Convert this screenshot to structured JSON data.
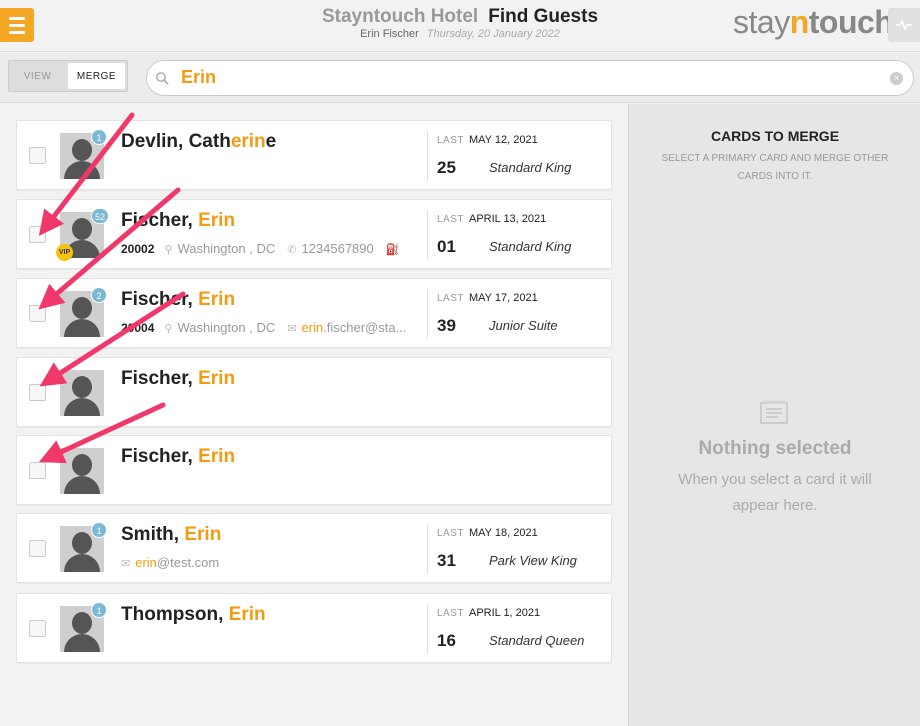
{
  "header": {
    "hotel": "Stayntouch Hotel",
    "page_title": "Find Guests",
    "user": "Erin Fischer",
    "date": "Thursday, 20 January 2022",
    "logo": {
      "pre": "stay",
      "n": "n",
      "post": "touch"
    }
  },
  "toolbar": {
    "view_label": "VIEW",
    "merge_label": "MERGE",
    "search_value": "Erin"
  },
  "last_label": "LAST",
  "guests": [
    {
      "name_pre": "Devlin, Cath",
      "name_hl": "erin",
      "name_post": "e",
      "badge": "1",
      "vip": "",
      "zip": "",
      "city": "",
      "contact": "",
      "contact_hl": "",
      "contact_rest": "",
      "last_date": "MAY 12, 2021",
      "room_no": "25",
      "room_type": "Standard King"
    },
    {
      "name_pre": "Fischer, ",
      "name_hl": "Erin",
      "name_post": "",
      "badge": "52",
      "vip": "VIP",
      "zip": "20002",
      "city": "Washington , DC",
      "contact": "1234567890",
      "contact_hl": "",
      "contact_rest": "",
      "last_date": "APRIL 13, 2021",
      "room_no": "01",
      "room_type": "Standard King"
    },
    {
      "name_pre": "Fischer, ",
      "name_hl": "Erin",
      "name_post": "",
      "badge": "2",
      "vip": "",
      "zip": "20004",
      "city": "Washington , DC",
      "contact": "",
      "contact_hl": "erin",
      "contact_rest": ".fischer@sta...",
      "last_date": "MAY 17, 2021",
      "room_no": "39",
      "room_type": "Junior Suite"
    },
    {
      "name_pre": "Fischer, ",
      "name_hl": "Erin",
      "name_post": ""
    },
    {
      "name_pre": "Fischer, ",
      "name_hl": "Erin",
      "name_post": ""
    },
    {
      "name_pre": "Smith, ",
      "name_hl": "Erin",
      "name_post": "",
      "badge": "1",
      "contact_hl": "erin",
      "contact_rest": "@test.com",
      "last_date": "MAY 18, 2021",
      "room_no": "31",
      "room_type": "Park View King"
    },
    {
      "name_pre": "Thompson, ",
      "name_hl": "Erin",
      "name_post": "",
      "badge": "1",
      "last_date": "APRIL 1, 2021",
      "room_no": "16",
      "room_type": "Standard Queen"
    }
  ],
  "panel": {
    "title": "CARDS TO MERGE",
    "subtitle": "SELECT A PRIMARY CARD AND MERGE OTHER CARDS INTO IT.",
    "empty_title": "Nothing selected",
    "empty_text": "When you select a card it will appear here."
  },
  "colors": {
    "accent": "#f5a623",
    "highlight": "#f39c12",
    "badge": "#7ab8d6",
    "vip": "#f5c20e",
    "arrow": "#f0386b"
  },
  "icons": [
    "menu-icon",
    "pulse-icon",
    "search-icon",
    "clear-icon",
    "location-icon",
    "phone-icon",
    "car-icon",
    "mail-icon",
    "document-icon"
  ]
}
